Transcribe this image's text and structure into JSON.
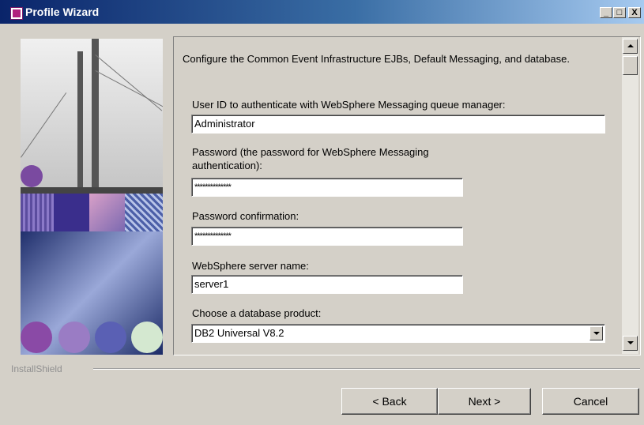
{
  "window": {
    "title": "Profile Wizard",
    "minimize": "_",
    "maximize": "□",
    "close": "X"
  },
  "main": {
    "intro": "Configure the Common Event Infrastructure EJBs, Default Messaging, and database.",
    "fields": [
      {
        "label": "User ID to authenticate with WebSphere Messaging queue manager:",
        "value": "Administrator"
      },
      {
        "label": "Password (the password for WebSphere Messaging authentication):",
        "value": "**************"
      },
      {
        "label": "Password confirmation:",
        "value": "**************"
      },
      {
        "label": "WebSphere server name:",
        "value": "server1"
      }
    ],
    "db_label": "Choose a database product:",
    "db_selected": "DB2 Universal V8.2"
  },
  "footer": {
    "brand": "InstallShield",
    "back": "< Back",
    "next": "Next >",
    "cancel": "Cancel"
  },
  "colors": {
    "titlebar_start": "#0a246a",
    "titlebar_end": "#a6caf0",
    "face": "#d4d0c8"
  }
}
